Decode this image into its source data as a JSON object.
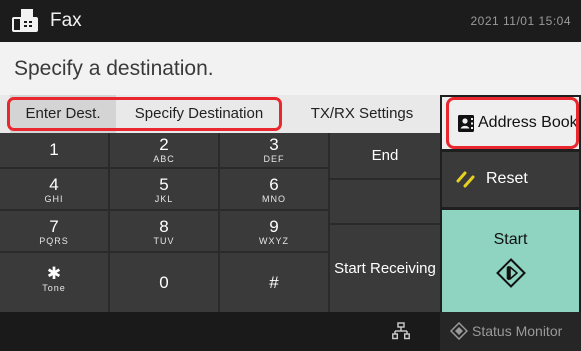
{
  "header": {
    "title": "Fax",
    "datetime": "2021 11/01 15:04",
    "icon": "fax-machine-icon"
  },
  "message": "Specify a destination.",
  "tabs": [
    {
      "label": "Enter Dest.",
      "selected": true
    },
    {
      "label": "Specify Destination",
      "selected": false
    },
    {
      "label": "TX/RX Settings",
      "selected": false
    }
  ],
  "keypad": {
    "keys": [
      {
        "main": "1",
        "sub": ""
      },
      {
        "main": "2",
        "sub": "ABC"
      },
      {
        "main": "3",
        "sub": "DEF"
      },
      {
        "main": "4",
        "sub": "GHI"
      },
      {
        "main": "5",
        "sub": "JKL"
      },
      {
        "main": "6",
        "sub": "MNO"
      },
      {
        "main": "7",
        "sub": "PQRS"
      },
      {
        "main": "8",
        "sub": "TUV"
      },
      {
        "main": "9",
        "sub": "WXYZ"
      },
      {
        "main": "✱",
        "sub": "Tone"
      },
      {
        "main": "0",
        "sub": ""
      },
      {
        "main": "#",
        "sub": ""
      }
    ],
    "end_label": "End",
    "start_receiving_label": "Start Receiving"
  },
  "side": {
    "address_book_label": "Address Book",
    "reset_label": "Reset",
    "start_label": "Start",
    "accent_color": "#8fd3c1",
    "reset_icon_color": "#e6d21e",
    "highlight_color": "#e8282e"
  },
  "bottom": {
    "status_monitor_label": "Status Monitor"
  }
}
